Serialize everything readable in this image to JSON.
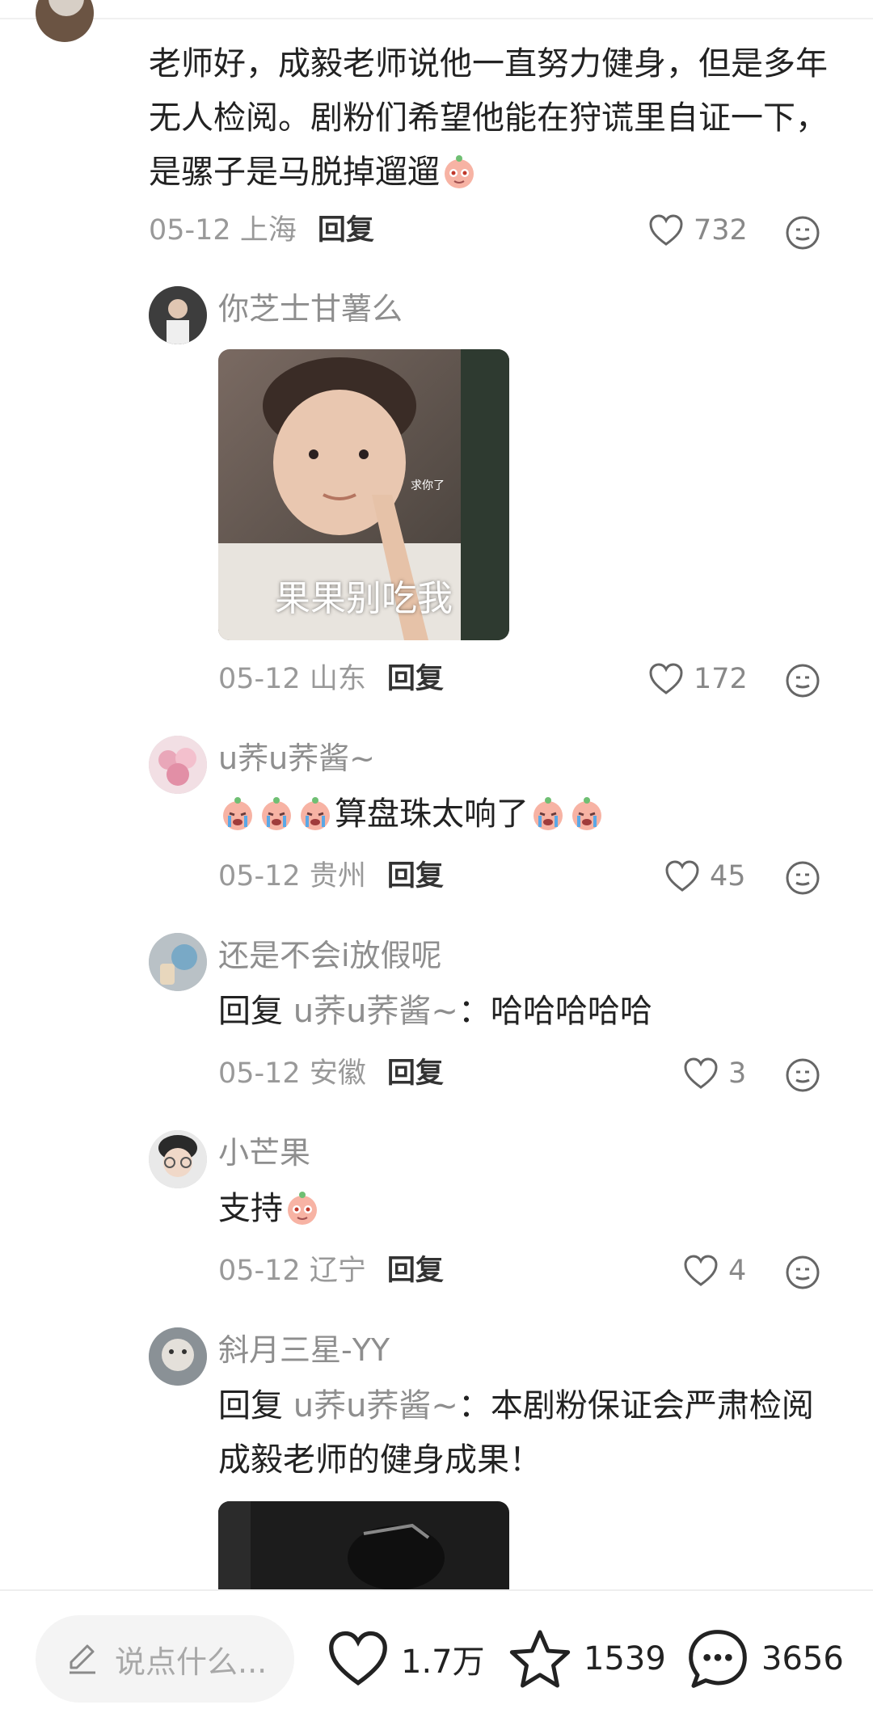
{
  "main_comment": {
    "text": "老师好，成毅老师说他一直努力健身，但是多年无人检阅。剧粉们希望他能在狩谎里自证一下，是骡子是马脱掉遛遛",
    "date_location": "05-12 上海",
    "reply_label": "回复",
    "likes": "732"
  },
  "replies": [
    {
      "username": "你芝士甘薯么",
      "sticker_small_text": "求你了",
      "sticker_caption": "果果别吃我",
      "date_location": "05-12 山东",
      "reply_label": "回复",
      "likes": "172"
    },
    {
      "username": "u荞u荞酱~",
      "text": "算盘珠太响了",
      "date_location": "05-12 贵州",
      "reply_label": "回复",
      "likes": "45"
    },
    {
      "username": "还是不会i放假呢",
      "reply_prefix": "回复",
      "reply_to": "u荞u荞酱~",
      "text": "：哈哈哈哈哈",
      "date_location": "05-12 安徽",
      "reply_label": "回复",
      "likes": "3"
    },
    {
      "username": "小芒果",
      "text": "支持",
      "date_location": "05-12 辽宁",
      "reply_label": "回复",
      "likes": "4"
    },
    {
      "username": "斜月三星-YY",
      "reply_prefix": "回复",
      "reply_to": "u荞u荞酱~",
      "text": "：本剧粉保证会严肃检阅成毅老师的健身成果！"
    }
  ],
  "bottom_bar": {
    "input_placeholder": "说点什么...",
    "likes": "1.7万",
    "favorites": "1539",
    "comments": "3656"
  },
  "icons": {
    "edit": "pencil-icon",
    "like": "heart-icon",
    "favorite": "star-icon",
    "comment": "chat-bubble-icon",
    "emoji": "emoji-face-icon"
  },
  "colors": {
    "text_primary": "#222222",
    "text_secondary": "#8e8e8e",
    "meta": "#999999",
    "input_bg": "#f4f4f4"
  }
}
